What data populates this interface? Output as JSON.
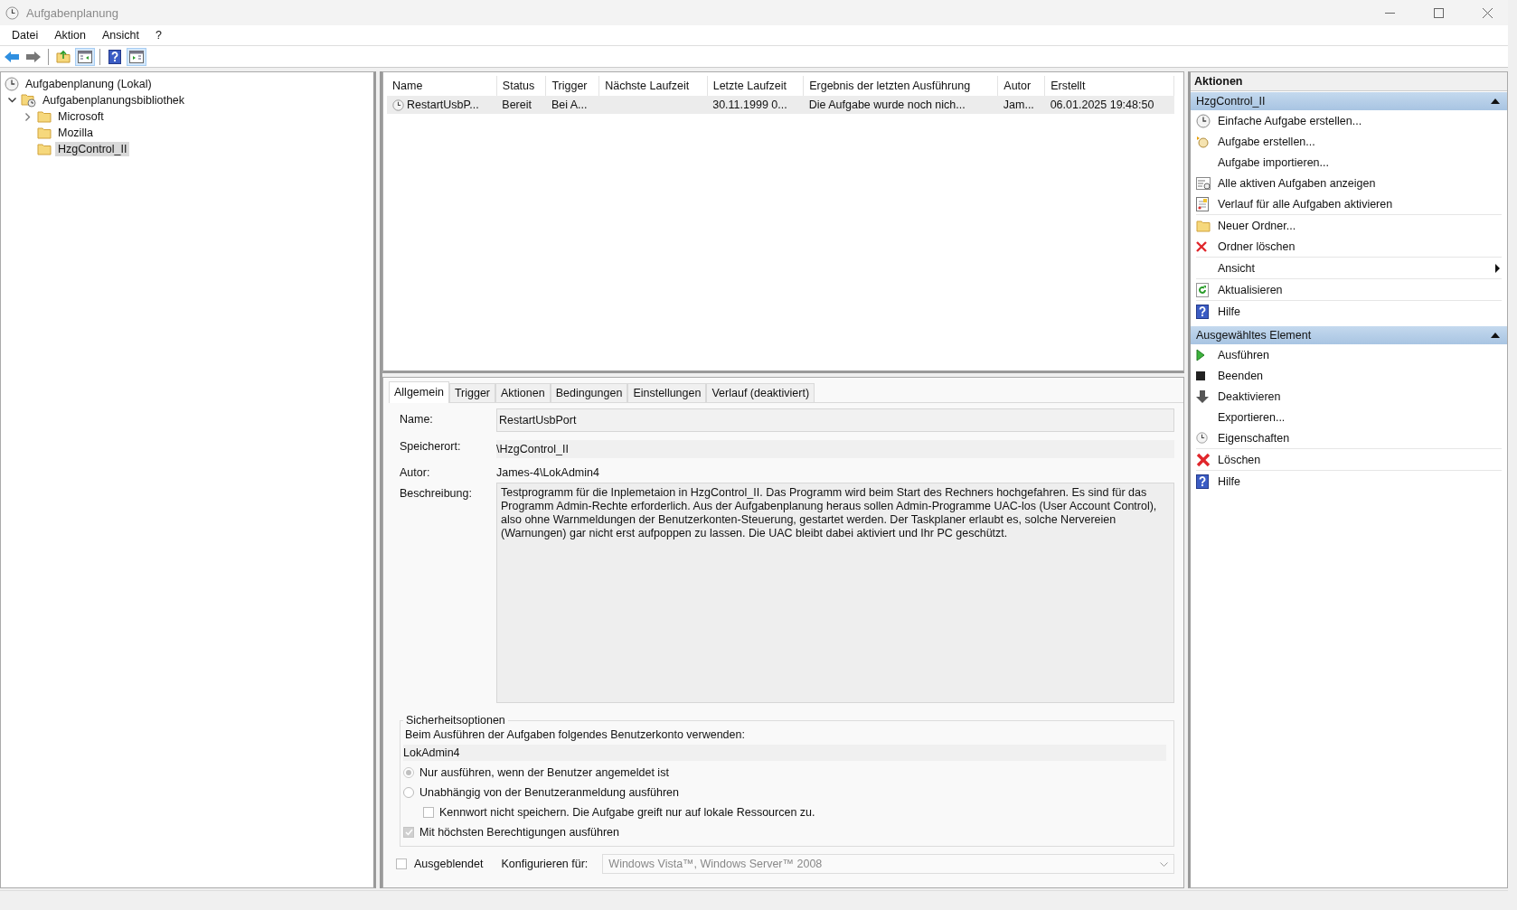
{
  "window": {
    "title": "Aufgabenplanung"
  },
  "menu": [
    "Datei",
    "Aktion",
    "Ansicht",
    "?"
  ],
  "toolbar": [
    {
      "kind": "back",
      "pressed": false
    },
    {
      "kind": "forward",
      "pressed": false
    },
    {
      "kind": "separator"
    },
    {
      "kind": "up",
      "pressed": false
    },
    {
      "kind": "tree-toggle",
      "pressed": true
    },
    {
      "kind": "separator"
    },
    {
      "kind": "help",
      "pressed": false
    },
    {
      "kind": "pane-toggle",
      "pressed": true
    }
  ],
  "tree": {
    "label": "Aufgabenplanung (Lokal)",
    "selected": false,
    "children": [
      {
        "label": "Aufgabenplanungsbibliothek",
        "selected": false,
        "expanded": true,
        "children": [
          {
            "label": "Microsoft",
            "selected": false,
            "expanded": false
          },
          {
            "label": "Mozilla",
            "selected": false
          },
          {
            "label": "HzgControl_II",
            "selected": true
          }
        ]
      }
    ]
  },
  "table": {
    "columns": [
      "Name",
      "Status",
      "Trigger",
      "Nächste Laufzeit",
      "Letzte Laufzeit",
      "Ergebnis der letzten Ausführung",
      "Autor",
      "Erstellt"
    ],
    "rows": [
      {
        "selected": true,
        "cells": [
          "RestartUsbP...",
          "Bereit",
          "Bei A...",
          "",
          "30.11.1999 0...",
          "Die Aufgabe wurde noch nich...",
          "Jam...",
          "06.01.2025 19:48:50"
        ]
      }
    ]
  },
  "tabs": [
    {
      "label": "Allgemein",
      "selected": true
    },
    {
      "label": "Trigger",
      "selected": false
    },
    {
      "label": "Aktionen",
      "selected": false
    },
    {
      "label": "Bedingungen",
      "selected": false
    },
    {
      "label": "Einstellungen",
      "selected": false
    },
    {
      "label": "Verlauf (deaktiviert)",
      "selected": false
    }
  ],
  "general": {
    "name_label": "Name:",
    "name": "RestartUsbPort",
    "location_label": "Speicherort:",
    "location": "\\HzgControl_II",
    "author_label": "Autor:",
    "author": "James-4\\LokAdmin4",
    "description_label": "Beschreibung:",
    "description": "Testprogramm für die Inplemetaion in HzgControl_II. Das Programm wird beim Start des Rechners hochgefahren. Es sind für das Programm Admin-Rechte erforderlich. Aus der Aufgabenplanung heraus sollen Admin-Programme UAC-los (User Account Control), also ohne Warnmeldungen der Benutzerkonten-Steuerung, gestartet werden.  Der Taskplaner erlaubt es, solche Nervereien (Warnungen) gar nicht erst aufpoppen zu lassen. Die UAC bleibt dabei aktiviert und Ihr PC geschützt."
  },
  "security": {
    "title": "Sicherheitsoptionen",
    "account_label": "Beim Ausführen der Aufgaben folgendes Benutzerkonto verwenden:",
    "account": "LokAdmin4",
    "options": [
      {
        "kind": "radio",
        "label": "Nur ausführen, wenn der Benutzer angemeldet ist",
        "checked": true
      },
      {
        "kind": "radio",
        "label": "Unabhängig von der Benutzeranmeldung ausführen",
        "checked": false,
        "children": [
          {
            "kind": "checkbox",
            "label": "Kennwort nicht speichern. Die Aufgabe greift nur auf lokale Ressourcen zu.",
            "checked": false
          }
        ]
      },
      {
        "kind": "checkbox",
        "label": "Mit höchsten Berechtigungen ausführen",
        "checked": true
      }
    ]
  },
  "hidden": {
    "label": "Ausgeblendet",
    "checked": false
  },
  "configure": {
    "label": "Konfigurieren für:",
    "value": "Windows Vista™, Windows Server™ 2008"
  },
  "actions": {
    "title": "Aktionen",
    "groups": [
      {
        "title": "HzgControl_II",
        "expanded": true,
        "items": [
          {
            "kind": "action",
            "label": "Einfache Aufgabe erstellen..."
          },
          {
            "kind": "action",
            "label": "Aufgabe erstellen..."
          },
          {
            "kind": "action",
            "label": "Aufgabe importieren..."
          },
          {
            "kind": "action",
            "label": "Alle aktiven Aufgaben anzeigen"
          },
          {
            "kind": "action",
            "label": "Verlauf für alle Aufgaben aktivieren"
          },
          {
            "kind": "separator"
          },
          {
            "kind": "action",
            "label": "Neuer Ordner..."
          },
          {
            "kind": "action",
            "label": "Ordner löschen"
          },
          {
            "kind": "separator"
          },
          {
            "kind": "submenu",
            "label": "Ansicht"
          },
          {
            "kind": "separator"
          },
          {
            "kind": "action",
            "label": "Aktualisieren"
          },
          {
            "kind": "separator"
          },
          {
            "kind": "action",
            "label": "Hilfe"
          }
        ]
      },
      {
        "title": "Ausgewähltes Element",
        "expanded": true,
        "items": [
          {
            "kind": "action",
            "label": "Ausführen"
          },
          {
            "kind": "action",
            "label": "Beenden"
          },
          {
            "kind": "action",
            "label": "Deaktivieren"
          },
          {
            "kind": "action",
            "label": "Exportieren..."
          },
          {
            "kind": "action",
            "label": "Eigenschaften"
          },
          {
            "kind": "separator"
          },
          {
            "kind": "action",
            "label": "Löschen"
          },
          {
            "kind": "separator"
          },
          {
            "kind": "action",
            "label": "Hilfe"
          }
        ]
      }
    ]
  }
}
